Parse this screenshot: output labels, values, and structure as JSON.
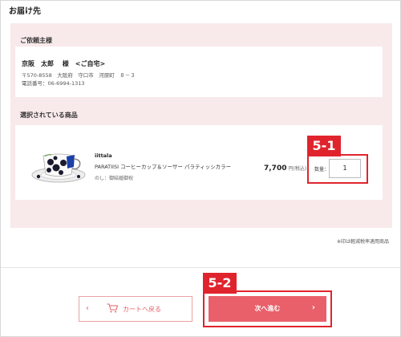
{
  "shipping": {
    "section_title": "お届け先",
    "customer_title": "ご依頼主様",
    "name": "京阪　太郎　 様　<ご自宅>",
    "postal_address": "〒570-8558　大阪府　守口市　河原町　８－３",
    "phone": "電話番号：06-6994-1313"
  },
  "products": {
    "title": "選択されている商品",
    "items": [
      {
        "brand": "iittala",
        "name": "PARATIISI コーヒーカップ＆ソーサー パラティッシカラー",
        "noshi": "のし：御結婚御祝",
        "price": "7,700",
        "price_note": "円(税込)",
        "qty_label": "数量：",
        "qty_value": "1"
      }
    ],
    "tax_note": "※印は軽減税率適用商品"
  },
  "annotations": {
    "qty_tag": "5-1",
    "next_tag": "5-2"
  },
  "buttons": {
    "back_label": "カートへ戻る",
    "next_label": "次へ進む",
    "back_chevron": "‹",
    "next_chevron": "›"
  },
  "colors": {
    "accent": "#e9606a",
    "annotation_red": "#e0242d",
    "panel_pink": "#f8e9ea"
  },
  "icons": {
    "back": "chevron-left-icon",
    "cart": "cart-icon",
    "next": "chevron-right-icon"
  }
}
